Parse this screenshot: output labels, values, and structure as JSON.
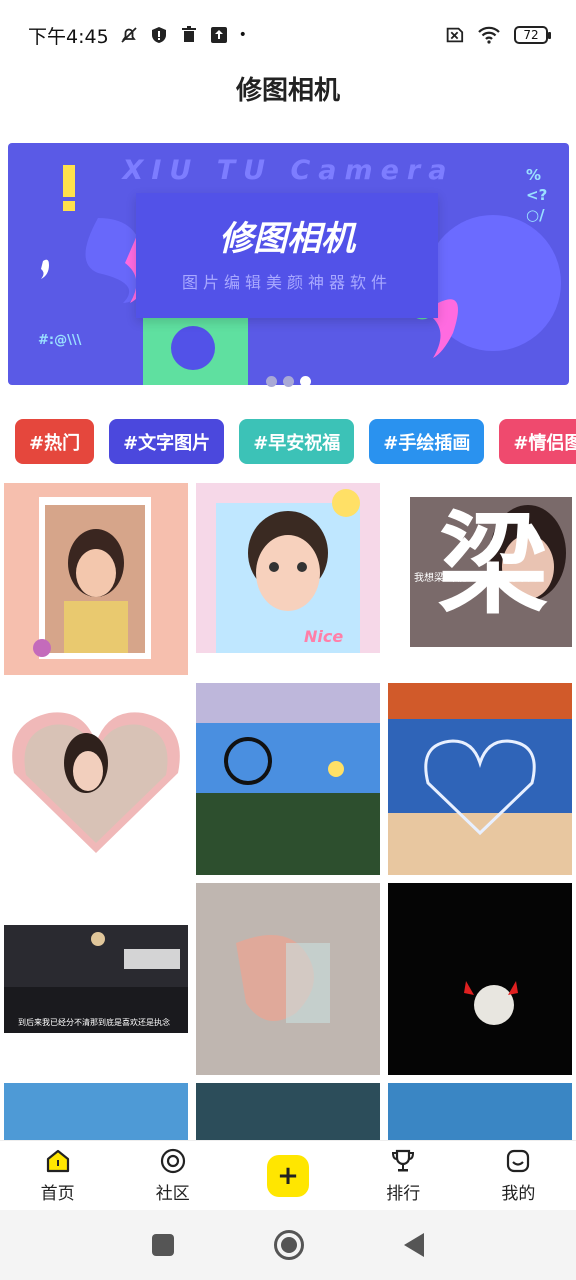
{
  "status": {
    "time": "下午4:45",
    "battery": "72"
  },
  "header": {
    "title": "修图相机"
  },
  "banner": {
    "en_title": "XIU TU Camera",
    "cn_title": "修图相机",
    "subtitle": "图片编辑美颜神器软件",
    "code_text": "#:@\\\\\\",
    "symbols": "%<?○/",
    "slides": 3,
    "active_slide": 3
  },
  "tags": [
    {
      "label": "#热门",
      "color": "#e5473d"
    },
    {
      "label": "#文字图片",
      "color": "#4b48dd"
    },
    {
      "label": "#早安祝福",
      "color": "#3cc2b7"
    },
    {
      "label": "#手绘插画",
      "color": "#2a92ef"
    },
    {
      "label": "#情侣图",
      "color": "#ef4a6e"
    }
  ],
  "grid_texts": {
    "tile3": "我想梁 却能温暖你所有不安",
    "tile7": "到后来我已经分不清那到底是喜欢还是执念",
    "tile2_sticker": "Nice"
  },
  "bottom_nav": [
    {
      "label": "首页",
      "icon": "home-icon"
    },
    {
      "label": "社区",
      "icon": "community-icon"
    },
    {
      "label": "",
      "icon": "add-icon"
    },
    {
      "label": "排行",
      "icon": "trophy-icon"
    },
    {
      "label": "我的",
      "icon": "profile-icon"
    }
  ],
  "add_symbol": "+"
}
